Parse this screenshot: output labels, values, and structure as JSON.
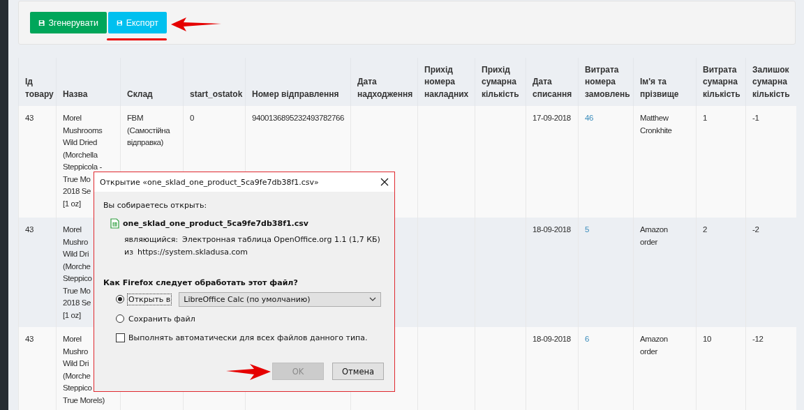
{
  "toolbar": {
    "buttons": [
      {
        "label": "Згенерувати",
        "kind": "generate"
      },
      {
        "label": "Експорт",
        "kind": "export"
      }
    ]
  },
  "table": {
    "columns": [
      {
        "label": "Ід товару"
      },
      {
        "label": "Назва"
      },
      {
        "label": "Склад"
      },
      {
        "label": "start_ostatok"
      },
      {
        "label": "Номер відправлення"
      },
      {
        "label": "Дата надходження"
      },
      {
        "label": "Прихід номера накладних"
      },
      {
        "label": "Прихід сумарна кількість"
      },
      {
        "label": "Дата списання"
      },
      {
        "label": "Витрата номера замовлень",
        "link": true
      },
      {
        "label": "Ім'я та прізвище"
      },
      {
        "label": "Витрата сумарна кількість"
      },
      {
        "label": "Залишок сумарна кількість"
      }
    ],
    "rows": [
      {
        "cells": [
          "43",
          [
            "Morel",
            "Mushrooms",
            "Wild Dried",
            "(Morchella",
            "Steppicola -",
            "True Mo",
            "2018 Se",
            "[1 oz]"
          ],
          "FBM\n(Самостійна\nвідправка)",
          "0",
          "9400136895232493782766",
          null,
          null,
          null,
          "17-09-2018",
          "46",
          "Matthew\nCronkhite",
          "1",
          "-1"
        ]
      },
      {
        "cells": [
          "43",
          [
            "Morel",
            "Mushro",
            "Wild Dri",
            "(Morche",
            "Steppico",
            "True Mo",
            "2018 Se",
            "[1 oz]"
          ],
          null,
          null,
          null,
          null,
          null,
          null,
          "18-09-2018",
          "5",
          "Amazon\norder",
          "2",
          "-2"
        ]
      },
      {
        "cells": [
          "43",
          [
            "Morel",
            "Mushro",
            "Wild Dri",
            "(Morche",
            "Steppico",
            "True Morels)"
          ],
          null,
          null,
          null,
          null,
          null,
          null,
          "18-09-2018",
          "6",
          "Amazon\norder",
          "10",
          "-12"
        ]
      }
    ]
  },
  "dialog": {
    "title": "Открытие «one_sklad_one_product_5ca9fe7db38f1.csv»",
    "intro": "Вы собираетесь открыть:",
    "file_name": "one_sklad_one_product_5ca9fe7db38f1.csv",
    "type_label": "являющийся:",
    "type_value": "Электронная таблица OpenOffice.org 1.1 (1,7 КБ)",
    "source_label": "из",
    "source_value": "https://system.skladusa.com",
    "question": "Как Firefox следует обработать этот файл?",
    "options": [
      {
        "label": "Открыть в",
        "selected": true,
        "focused": true,
        "app": "LibreOffice Calc (по умолчанию)"
      },
      {
        "label": "Сохранить файл",
        "selected": false,
        "focused": false
      }
    ],
    "auto_checkbox": {
      "label": "Выполнять автоматически для всех файлов данного типа.",
      "checked": false
    },
    "buttons": [
      {
        "label": "OK",
        "disabled": true
      },
      {
        "label": "Отмена",
        "disabled": false
      }
    ]
  }
}
